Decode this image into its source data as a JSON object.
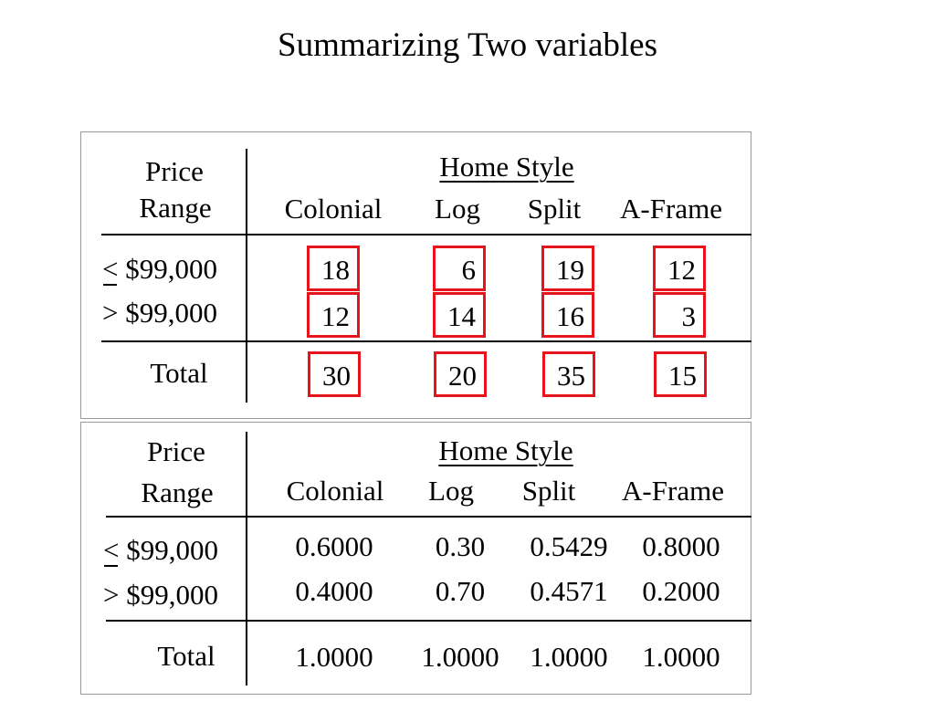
{
  "title": "Summarizing Two variables",
  "tables": [
    {
      "row_header_line1": "Price",
      "row_header_line2": "Range",
      "column_group": "Home Style",
      "columns": [
        "Colonial",
        "Log",
        "Split",
        "A-Frame"
      ],
      "rows": [
        {
          "op": "<",
          "label": " $99,000",
          "values": [
            "18",
            "6",
            "19",
            "12"
          ]
        },
        {
          "op": ">",
          "label": " $99,000",
          "values": [
            "12",
            "14",
            "16",
            "3"
          ]
        }
      ],
      "total_label": "Total",
      "totals": [
        "30",
        "20",
        "35",
        "15"
      ],
      "highlight_color": "#e8141c"
    },
    {
      "row_header_line1": "Price",
      "row_header_line2": "Range",
      "column_group": "Home Style",
      "columns": [
        "Colonial",
        "Log",
        "Split",
        "A-Frame"
      ],
      "rows": [
        {
          "op": "<",
          "label": " $99,000",
          "values": [
            "0.6000",
            "0.30",
            "0.5429",
            "0.8000"
          ]
        },
        {
          "op": ">",
          "label": " $99,000",
          "values": [
            "0.4000",
            "0.70",
            "0.4571",
            "0.2000"
          ]
        }
      ],
      "total_label": "Total",
      "totals": [
        "1.0000",
        "1.0000",
        "1.0000",
        "1.0000"
      ]
    }
  ]
}
